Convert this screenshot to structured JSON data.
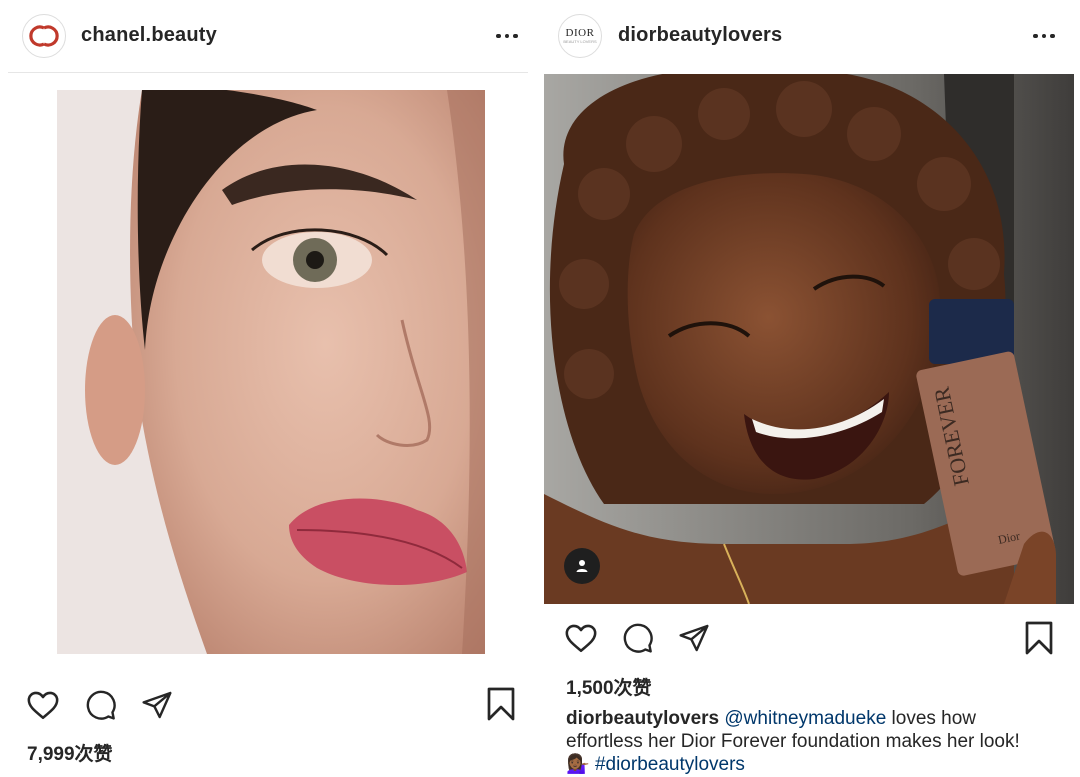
{
  "left_post": {
    "username": "chanel.beauty",
    "avatar_icon": "chanel-cc-logo",
    "likes": "7,999次赞"
  },
  "right_post": {
    "username": "diorbeautylovers",
    "avatar_logo": {
      "main": "DIOR",
      "sub": "BEAUTY LOVERS"
    },
    "likes": "1,500次赞",
    "caption": {
      "user": "diorbeautylovers",
      "mention": "@whitneymadueke",
      "text_1": " loves how effortless her Dior Forever foundation makes her look! ",
      "emoji": "💁🏾‍♀️",
      "hashtag": "#diorbeautylovers"
    },
    "product_label": {
      "name": "FOREVER",
      "brand": "Dior"
    }
  },
  "icons": [
    "more-icon",
    "heart-icon",
    "comment-icon",
    "share-icon",
    "bookmark-icon",
    "user-tag-icon"
  ],
  "colors": {
    "chanel_red": "#c0392b",
    "link_blue": "#00376b"
  }
}
